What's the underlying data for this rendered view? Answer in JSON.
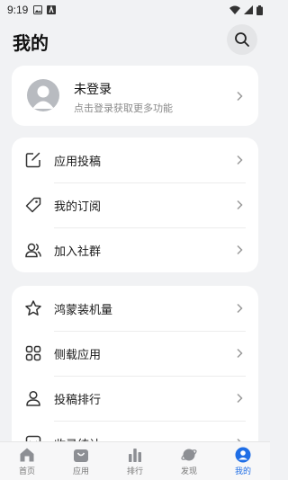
{
  "status_bar": {
    "time": "9:19"
  },
  "header": {
    "title": "我的"
  },
  "login": {
    "title": "未登录",
    "subtitle": "点击登录获取更多功能"
  },
  "menu_group_1": [
    {
      "label": "应用投稿",
      "icon": "edit-square-icon"
    },
    {
      "label": "我的订阅",
      "icon": "tag-icon"
    },
    {
      "label": "加入社群",
      "icon": "group-icon"
    }
  ],
  "menu_group_2": [
    {
      "label": "鸿蒙装机量",
      "icon": "star-icon"
    },
    {
      "label": "侧载应用",
      "icon": "grid-icon"
    },
    {
      "label": "投稿排行",
      "icon": "person-icon"
    },
    {
      "label": "收录统计",
      "icon": "chart-box-icon"
    }
  ],
  "bottom_nav": [
    {
      "label": "首页",
      "icon": "home-icon",
      "active": false
    },
    {
      "label": "应用",
      "icon": "app-store-icon",
      "active": false
    },
    {
      "label": "排行",
      "icon": "bar-chart-icon",
      "active": false
    },
    {
      "label": "发现",
      "icon": "planet-icon",
      "active": false
    },
    {
      "label": "我的",
      "icon": "profile-icon",
      "active": true
    }
  ],
  "colors": {
    "accent": "#1f6ee6",
    "background": "#f1f2f4",
    "card": "#ffffff"
  }
}
